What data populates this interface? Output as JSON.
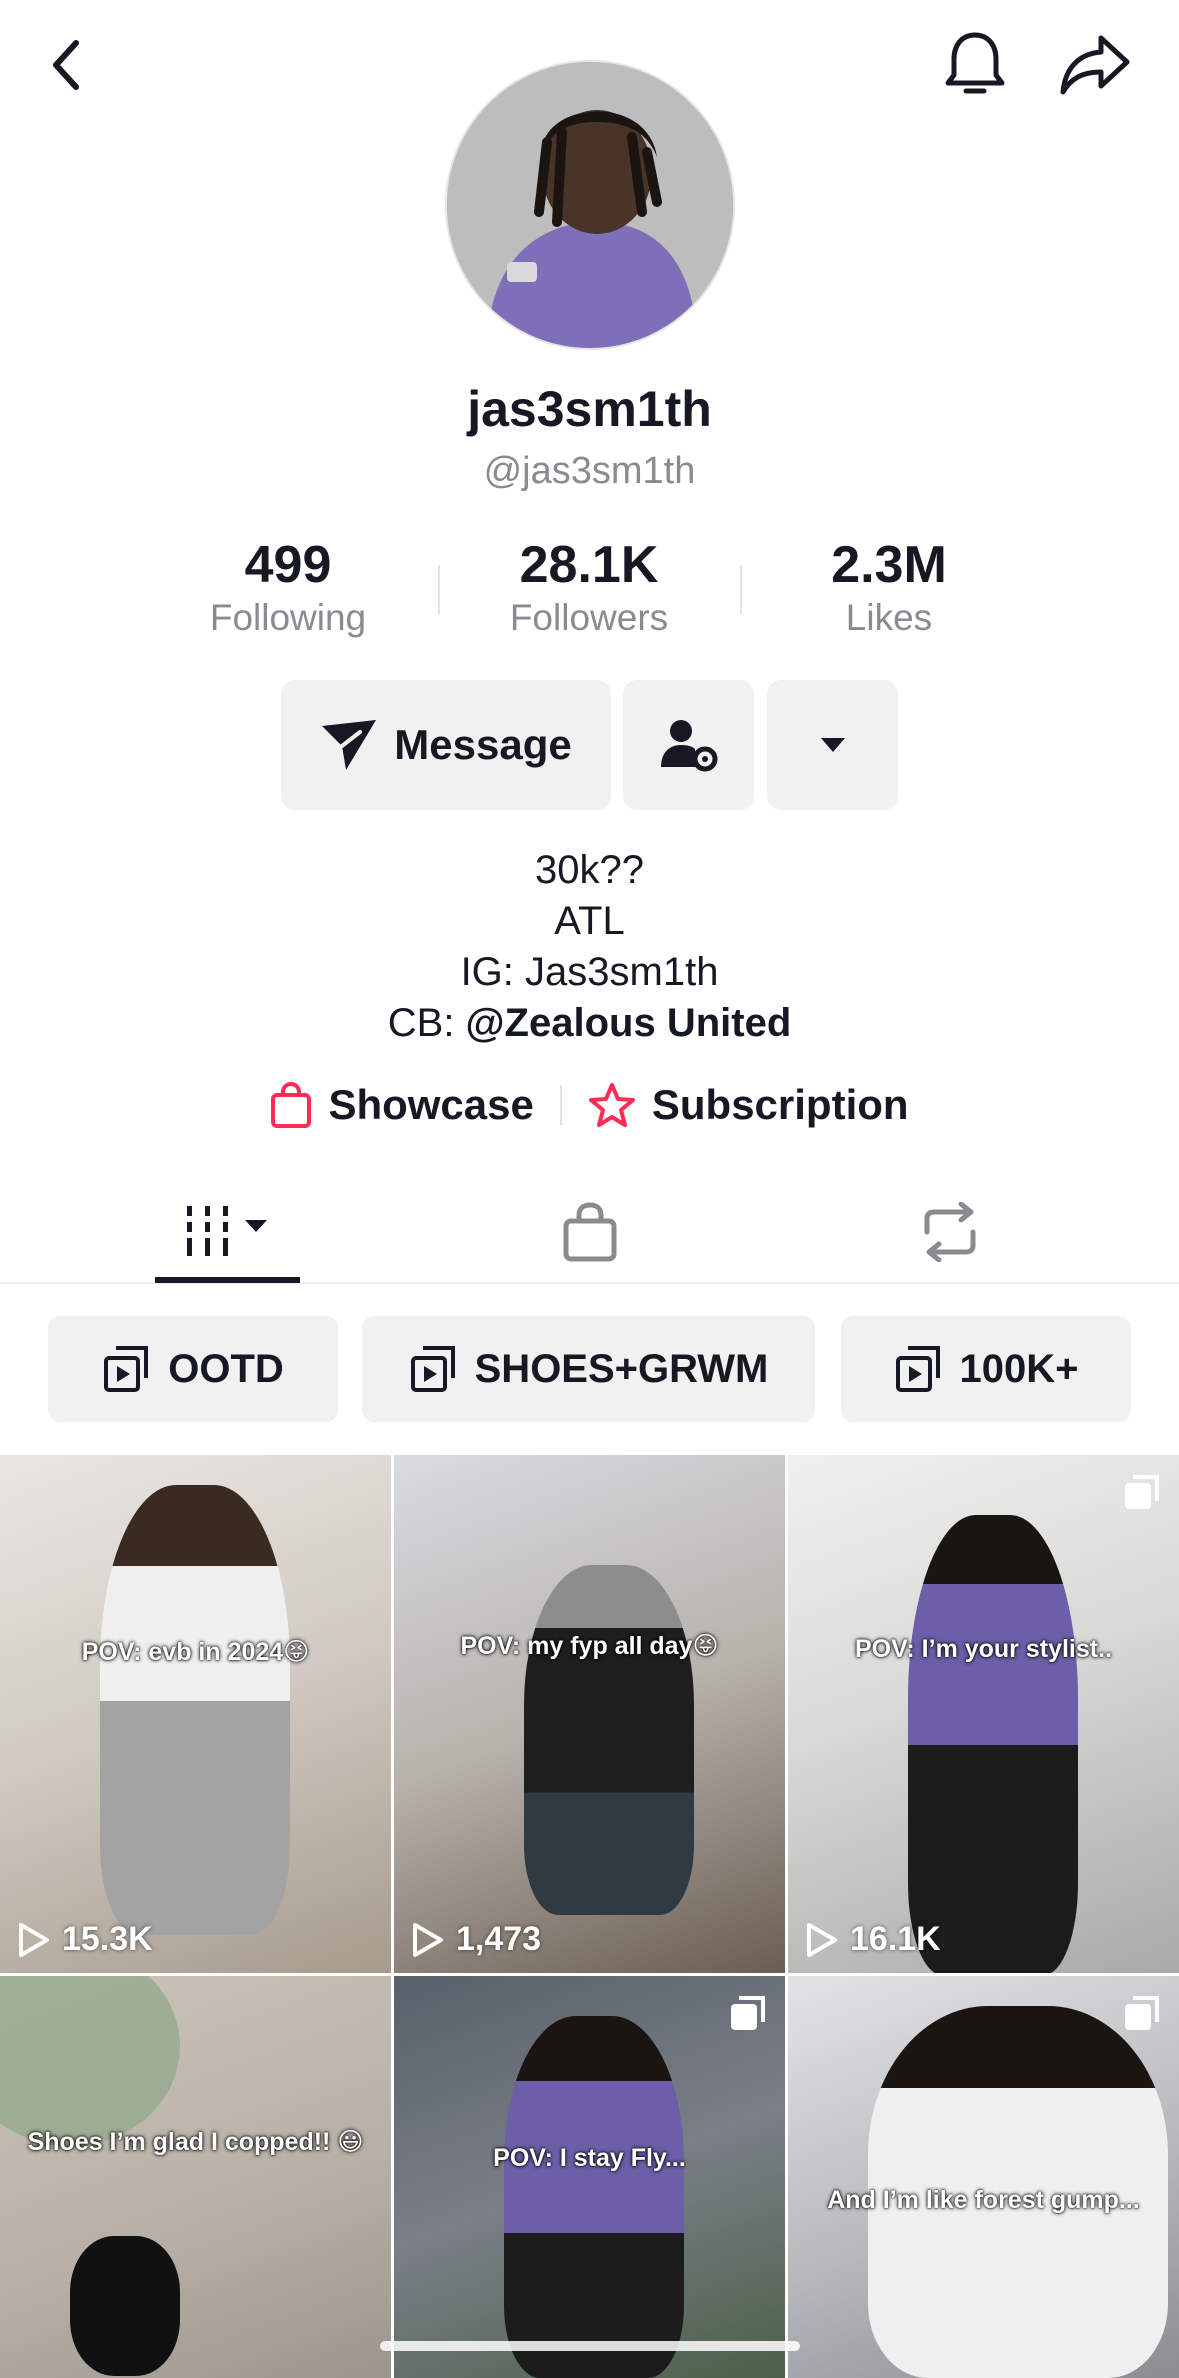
{
  "profile": {
    "display_name": "jas3sm1th",
    "handle": "@jas3sm1th"
  },
  "stats": {
    "following": {
      "value": "499",
      "label": "Following"
    },
    "followers": {
      "value": "28.1K",
      "label": "Followers"
    },
    "likes": {
      "value": "2.3M",
      "label": "Likes"
    }
  },
  "actions": {
    "message_label": "Message"
  },
  "bio": {
    "line1": "30k??",
    "line2": "ATL",
    "line3": "IG: Jas3sm1th",
    "line4_prefix": "CB: ",
    "line4_mention": "@Zealous United"
  },
  "links": {
    "showcase": "Showcase",
    "subscription": "Subscription"
  },
  "playlists": [
    {
      "label": "OOTD"
    },
    {
      "label": "SHOES+GRWM"
    },
    {
      "label": "100K+"
    }
  ],
  "videos": [
    {
      "caption": "POV: evb in 2024😝",
      "views": "15.3K"
    },
    {
      "caption": "POV: my fyp all day😝",
      "views": "1,473"
    },
    {
      "caption": "POV: I’m your stylist..",
      "views": "16.1K"
    },
    {
      "caption": "Shoes I’m glad I copped!! 😃",
      "views": ""
    },
    {
      "caption": "POV: I stay Fly...",
      "views": ""
    },
    {
      "caption": "And I’m like forest gump...",
      "views": ""
    }
  ],
  "icons": {
    "back": "chevron-left-icon",
    "bell": "bell-icon",
    "share": "share-arrow-icon",
    "message": "paper-plane-icon",
    "friend": "user-gear-icon",
    "more": "caret-down-icon",
    "showcase": "shopping-bag-icon",
    "subscription": "star-icon",
    "tab_videos": "grid-bars-icon",
    "tab_shop": "shopping-bag-icon",
    "tab_repost": "repost-icon",
    "playlist": "playlist-icon",
    "play": "play-icon"
  },
  "colors": {
    "text": "#161823",
    "muted": "#8a8b91",
    "button_bg": "#f1f1f2",
    "accent_red": "#fe2c55"
  }
}
